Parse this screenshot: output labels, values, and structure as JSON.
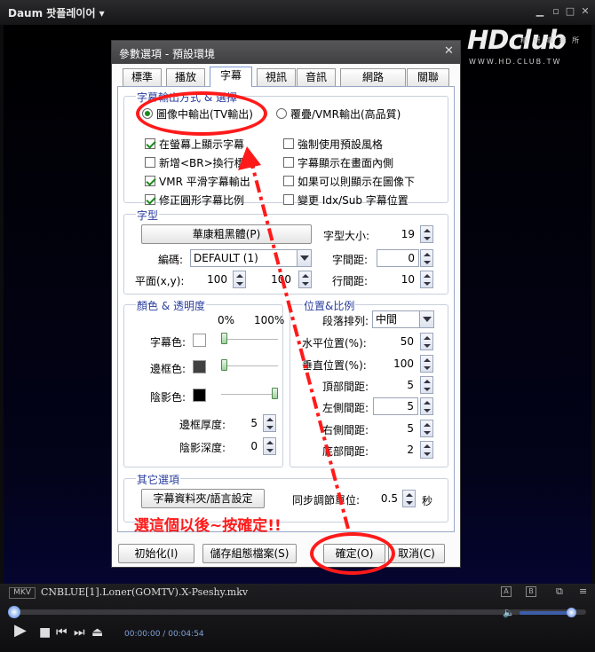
{
  "player": {
    "title": "Daum 팟플레이어",
    "format_badge": "MKV",
    "filename": "CNBLUE[1].Loner(GOMTV).X-Pseshy.mkv",
    "ab_a": "A",
    "ab_b": "B",
    "time_current": "00:00:00",
    "time_separator": "/",
    "time_total": "00:04:54",
    "seek_progress": 0,
    "volume_level": 1.0
  },
  "watermark": {
    "logo": "HDclub",
    "subtitle": "精 研 事 務 所",
    "url": "WWW.HD.CLUB.TW"
  },
  "dialog": {
    "title": "參數選項 - 預設環境",
    "tabs": [
      {
        "label": "標準"
      },
      {
        "label": "播放"
      },
      {
        "label": "字幕"
      },
      {
        "label": "視訊"
      },
      {
        "label": "音訊"
      },
      {
        "label": "網路"
      },
      {
        "label": "關聯"
      }
    ],
    "output": {
      "group_label": "字幕輸出方式 & 選擇",
      "radio_image": "圖像中輸出(TV輸出)",
      "radio_overlay": "覆疊/VMR輸出(高品質)",
      "checkboxes": [
        {
          "label": "在螢幕上顯示字幕",
          "checked": true
        },
        {
          "label": "強制使用預設風格",
          "checked": false
        },
        {
          "label": "新增<BR>換行標籤",
          "checked": false
        },
        {
          "label": "字幕顯示在畫面內側",
          "checked": false
        },
        {
          "label": "VMR 平滑字幕輸出",
          "checked": true
        },
        {
          "label": "如果可以則顯示在圖像下",
          "checked": false
        },
        {
          "label": "修正圓形字幕比例",
          "checked": true
        },
        {
          "label": "變更 Idx/Sub 字幕位置",
          "checked": false
        }
      ]
    },
    "font": {
      "group_label": "字型",
      "font_button": "華康粗黑體(P)",
      "size_label": "字型大小:",
      "size_value": "19",
      "encoding_label": "編碼:",
      "encoding_value": "DEFAULT (1)",
      "spacing_label": "字間距:",
      "spacing_value": "0",
      "plane_label": "平面(x,y):",
      "plane_x": "100",
      "plane_y": "100",
      "line_spacing_label": "行間距:",
      "line_spacing_value": "10"
    },
    "color": {
      "group_label": "顏色 & 透明度",
      "pct_min": "0%",
      "pct_max": "100%",
      "subtitle_label": "字幕色:",
      "subtitle_color": "#ffffff",
      "subtitle_opacity": 0,
      "border_label": "邊框色:",
      "border_color": "#404040",
      "border_opacity": 0,
      "shadow_label": "陰影色:",
      "shadow_color": "#000000",
      "shadow_opacity": 1,
      "border_thickness_label": "邊框厚度:",
      "border_thickness_value": "5",
      "shadow_depth_label": "陰影深度:",
      "shadow_depth_value": "0"
    },
    "position": {
      "group_label": "位置&比例",
      "align_label": "段落排列:",
      "align_value": "中間",
      "horizontal_label": "水平位置(%):",
      "horizontal_value": "50",
      "vertical_label": "垂直位置(%):",
      "vertical_value": "100",
      "top_margin_label": "頂部間距:",
      "top_margin_value": "5",
      "left_margin_label": "左側間距:",
      "left_margin_value": "5",
      "right_margin_label": "右側間距:",
      "right_margin_value": "5",
      "bottom_margin_label": "底部間距:",
      "bottom_margin_value": "2"
    },
    "other": {
      "group_label": "其它選項",
      "folder_button": "字幕資料夾/語言設定",
      "sync_label": "同步調節單位:",
      "sync_value": "0.5",
      "sync_unit": "秒"
    },
    "buttons": {
      "init": "初始化(I)",
      "save_config": "儲存組態檔案(S)",
      "ok": "確定(O)",
      "cancel": "取消(C)"
    }
  },
  "annotation": {
    "text": "選這個以後~按確定!!",
    "color": "#ff1a1a"
  }
}
